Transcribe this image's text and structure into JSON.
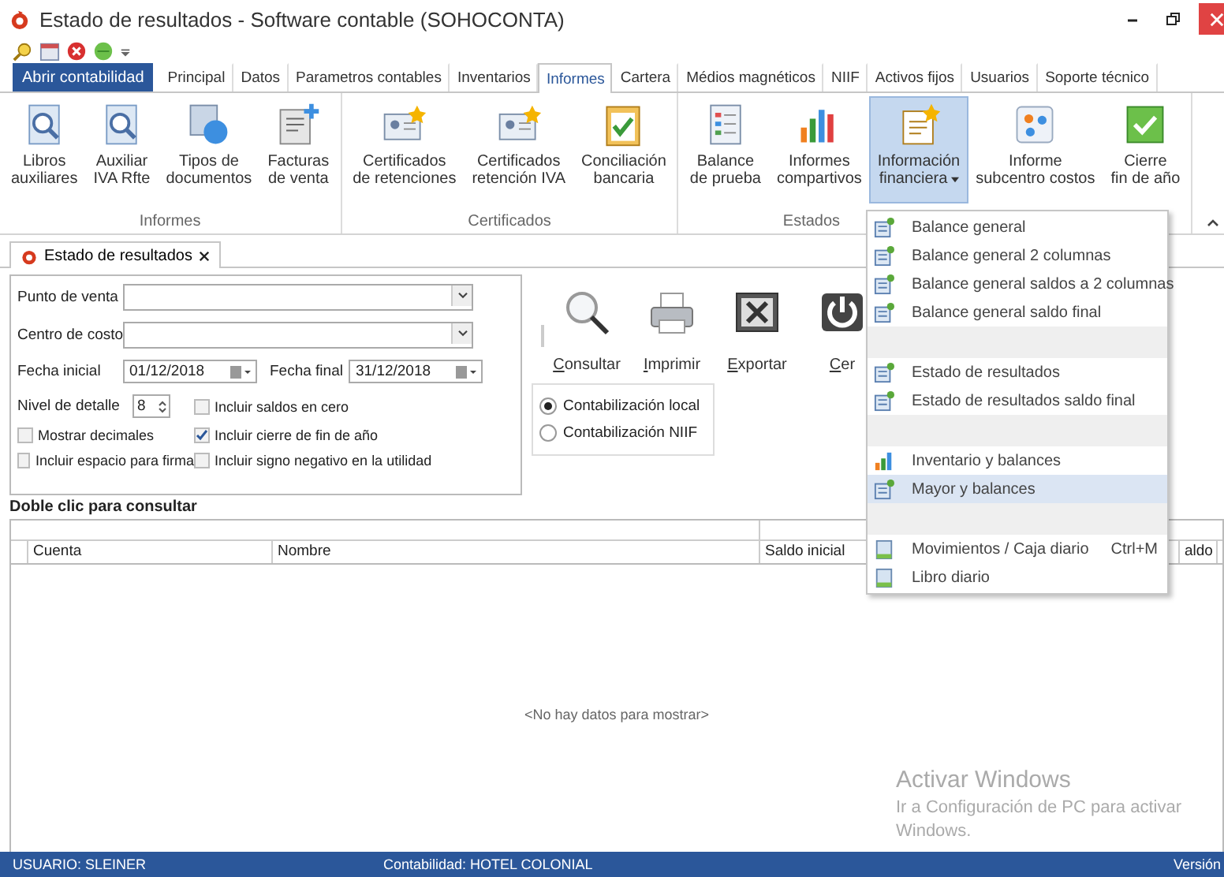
{
  "window": {
    "title": "Estado de resultados - Software contable (SOHOCONTA)"
  },
  "open_button": {
    "label": "Abrir contabilidad"
  },
  "tabs": [
    {
      "label": "Principal",
      "selected": false
    },
    {
      "label": "Datos",
      "selected": false
    },
    {
      "label": "Parametros contables",
      "selected": false
    },
    {
      "label": "Inventarios",
      "selected": false
    },
    {
      "label": "Informes",
      "selected": true
    },
    {
      "label": "Cartera",
      "selected": false
    },
    {
      "label": "Médios magnéticos",
      "selected": false
    },
    {
      "label": "NIIF",
      "selected": false
    },
    {
      "label": "Activos fijos",
      "selected": false
    },
    {
      "label": "Usuarios",
      "selected": false
    },
    {
      "label": "Soporte técnico",
      "selected": false
    }
  ],
  "ribbon_groups": [
    {
      "label": "Informes",
      "buttons": [
        {
          "label": "Libros auxiliares",
          "kind": "magnifier",
          "selected": false
        },
        {
          "label": "Auxiliar IVA Rfte",
          "kind": "magnifier",
          "selected": false
        },
        {
          "label": "Tipos de documentos",
          "kind": "shapes",
          "selected": false
        },
        {
          "label": "Facturas de venta",
          "kind": "invoice",
          "selected": false
        }
      ]
    },
    {
      "label": "Certificados",
      "buttons": [
        {
          "label": "Certificados de retenciones",
          "kind": "certificate",
          "selected": false
        },
        {
          "label": "Certificados retención IVA",
          "kind": "certificate",
          "selected": false
        },
        {
          "label": "Conciliación bancaria",
          "kind": "clipboard",
          "selected": false
        }
      ]
    },
    {
      "label": "Estados",
      "buttons": [
        {
          "label": "Balance de prueba",
          "kind": "list",
          "selected": false
        },
        {
          "label": "Informes compartivos",
          "kind": "chart",
          "selected": false
        },
        {
          "label": "Información financiera",
          "kind": "report",
          "selected": true,
          "dropdown": true
        },
        {
          "label": "Informe subcentro costos",
          "kind": "dots",
          "selected": false
        },
        {
          "label": "Cierre fin de año",
          "kind": "check",
          "selected": false
        }
      ]
    }
  ],
  "document_tab": {
    "label": "Estado de resultados"
  },
  "form": {
    "punto_de_venta": {
      "label": "Punto de venta"
    },
    "centro_de_costo": {
      "label": "Centro de costo"
    },
    "fecha_inicial": {
      "label": "Fecha inicial",
      "value": "01/12/2018"
    },
    "fecha_final": {
      "label": "Fecha final",
      "value": "31/12/2018"
    },
    "nivel_de_detalle": {
      "label": "Nivel de detalle",
      "value": "8"
    },
    "checkboxes": [
      {
        "label": "Incluir saldos en cero",
        "checked": false
      },
      {
        "label": "Mostrar decimales",
        "checked": false
      },
      {
        "label": "Incluir cierre de fin de año",
        "checked": true
      },
      {
        "label": "Incluir espacio para firma",
        "checked": false
      },
      {
        "label": "Incluir signo negativo en la utilidad",
        "checked": false
      }
    ]
  },
  "actions": [
    {
      "label": "Consultar",
      "kind": "search"
    },
    {
      "label": "Imprimir",
      "kind": "print"
    },
    {
      "label": "Exportar",
      "kind": "excel"
    },
    {
      "label": "Cer",
      "kind": "power"
    }
  ],
  "radios": [
    {
      "label": "Contabilización local",
      "selected": true
    },
    {
      "label": "Contabilización NIIF",
      "selected": false
    }
  ],
  "hint": "Doble clic para consultar",
  "table": {
    "columns": [
      "Cuenta",
      "Nombre",
      "Saldo inicial",
      "aldo"
    ],
    "empty_message": "<No hay datos para mostrar>"
  },
  "menu": [
    {
      "kind": "report",
      "label": "Balance general",
      "selected": false
    },
    {
      "kind": "report",
      "label": "Balance general 2 columnas",
      "selected": false
    },
    {
      "kind": "report",
      "label": "Balance general saldos a 2 columnas",
      "selected": false
    },
    {
      "kind": "report",
      "label": "Balance general saldo final",
      "selected": false
    },
    {
      "kind": "separator"
    },
    {
      "kind": "report",
      "label": "Estado de resultados",
      "selected": false
    },
    {
      "kind": "report",
      "label": "Estado de resultados saldo final",
      "selected": false
    },
    {
      "kind": "separator"
    },
    {
      "kind": "chart",
      "label": "Inventario y balances",
      "selected": false
    },
    {
      "kind": "report",
      "label": "Mayor y balances",
      "selected": true
    },
    {
      "kind": "separator"
    },
    {
      "kind": "journal",
      "label": "Movimientos / Caja diario",
      "shortcut": "Ctrl+M",
      "selected": false
    },
    {
      "kind": "journal",
      "label": "Libro diario",
      "selected": false
    }
  ],
  "activation": {
    "title": "Activar Windows",
    "text": "Ir a Configuración de PC para activar Windows."
  },
  "status_bar": {
    "user": "USUARIO: SLEINER",
    "company": "Contabilidad: HOTEL COLONIAL",
    "version": "Versión"
  }
}
